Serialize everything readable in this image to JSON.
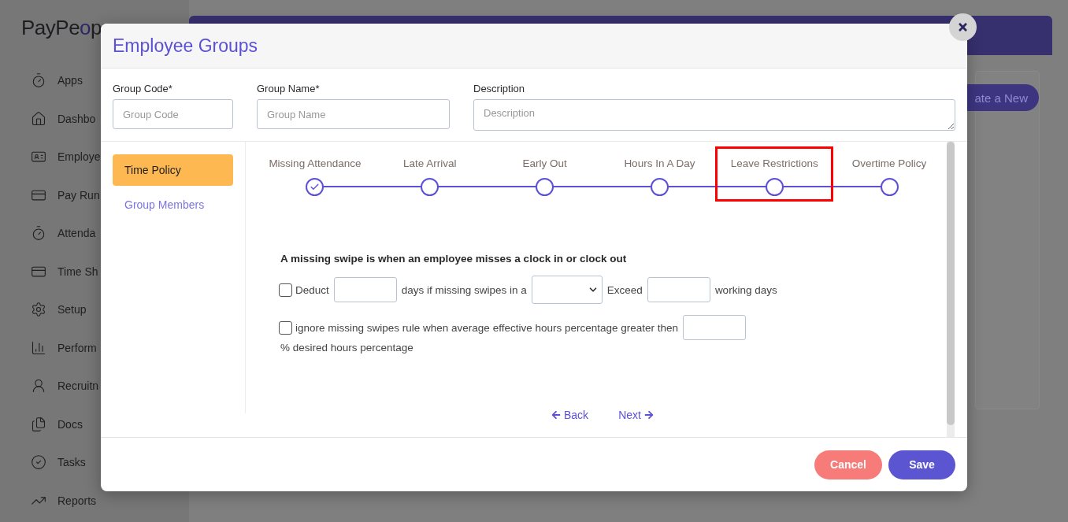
{
  "logo": {
    "text_main": "PayPe",
    "text_accent": "o",
    "text_tail": "p"
  },
  "sidebar": {
    "items": [
      {
        "label": "Apps",
        "kind": "timer"
      },
      {
        "label": "Dashbo",
        "kind": "home"
      },
      {
        "label": "Employe",
        "kind": "card"
      },
      {
        "label": "Pay Run",
        "kind": "payment"
      },
      {
        "label": "Attenda",
        "kind": "timer"
      },
      {
        "label": "Time Sh",
        "kind": "payment"
      },
      {
        "label": "Setup",
        "kind": "settings"
      },
      {
        "label": "Perform",
        "kind": "chart"
      },
      {
        "label": "Recruitn",
        "kind": "person"
      },
      {
        "label": "Docs",
        "kind": "docs"
      },
      {
        "label": "Tasks",
        "kind": "check"
      },
      {
        "label": "Reports",
        "kind": "growth"
      }
    ]
  },
  "background_button": "ate a New",
  "dialog": {
    "title": "Employee Groups",
    "fields": [
      {
        "label": "Group Code*",
        "placeholder": "Group Code",
        "kind": "input"
      },
      {
        "label": "Group Name*",
        "placeholder": "Group Name",
        "kind": "input"
      },
      {
        "label": "Description",
        "placeholder": "Description",
        "kind": "textarea"
      }
    ],
    "nav": [
      {
        "label": "Time Policy",
        "selected": true
      },
      {
        "label": "Group Members",
        "selected": false
      }
    ],
    "steps": [
      {
        "label": "Missing Attendance",
        "done": true,
        "highlighted": false
      },
      {
        "label": "Late Arrival",
        "done": false,
        "highlighted": false
      },
      {
        "label": "Early Out",
        "done": false,
        "highlighted": false
      },
      {
        "label": "Hours In A Day",
        "done": false,
        "highlighted": false
      },
      {
        "label": "Leave Restrictions",
        "done": false,
        "highlighted": true
      },
      {
        "label": "Overtime Policy",
        "done": false,
        "highlighted": false
      }
    ],
    "heading": "A missing swipe is when an employee misses a clock in or clock out",
    "rules": [
      {
        "kind": "deduct",
        "checked": false,
        "label": "Deduct",
        "text_1": "days if missing swipes in a",
        "text_2": "Exceed",
        "text_3": "working days"
      },
      {
        "kind": "threshold",
        "checked": false,
        "label": "ignore missing swipes rule when average effective hours percentage greater then",
        "suffix": "% desired hours percentage"
      }
    ],
    "back": "Back",
    "next": "Next",
    "buttons": [
      {
        "label": "Cancel",
        "kind": "cancel"
      },
      {
        "label": "Save",
        "kind": "save"
      }
    ]
  }
}
